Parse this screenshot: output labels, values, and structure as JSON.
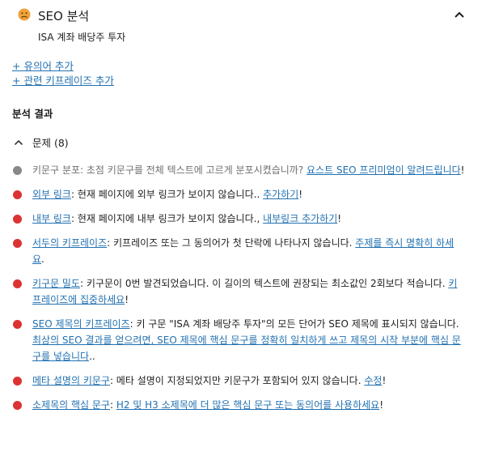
{
  "colors": {
    "accent": "#2271b1",
    "bad": "#dc3232",
    "neutral": "#888888",
    "face": "#f0a23b"
  },
  "header": {
    "icon": "face-icon",
    "title": "SEO 분석",
    "subtitle": "ISA 계좌 배당주 투자",
    "collapse_icon": "chevron-up-icon"
  },
  "add_links": [
    "+ 유의어 추가",
    "+ 관련 키프레이즈 추가"
  ],
  "section_title": "분석 결과",
  "problems": {
    "icon": "chevron-up-icon",
    "label": "문제 (8)"
  },
  "results": [
    {
      "status": "neutral",
      "text": "키문구 분포: 초점 키문구를 전체 텍스트에 고르게 분포시켰습니까? ",
      "action": "요스트 SEO 프리미엄이 알려드립니다",
      "suffix": "!"
    },
    {
      "status": "bad",
      "title": "외부 링크",
      "text": ": 현재 페이지에 외부 링크가 보이지 않습니다.. ",
      "action": "추가하기",
      "suffix": "!"
    },
    {
      "status": "bad",
      "title": "내부 링크",
      "text": ": 현재 페이지에 내부 링크가 보이지 않습니다., ",
      "action": "내부링크 추가하기",
      "suffix": "!"
    },
    {
      "status": "bad",
      "title": "서두의 키프레이즈",
      "text": ": 키프레이즈 또는 그 동의어가 첫 단락에 나타나지 않습니다. ",
      "action": "주제를 즉시 명확히 하세요",
      "suffix": "."
    },
    {
      "status": "bad",
      "title": "키구문 밀도",
      "text": ": 키구문이 0번 발견되었습니다. 이 길이의 텍스트에 권장되는 최소값인 2회보다 적습니다. ",
      "action": "키프레이즈에 집중하세요",
      "suffix": "!"
    },
    {
      "status": "bad",
      "title": "SEO 제목의 키프레이즈",
      "text": ": 키 구문 \"ISA 계좌 배당주 투자\"의 모든 단어가 SEO 제목에 표시되지 않습니다. ",
      "action": "최상의 SEO 결과를 얻으려면, SEO 제목에 핵심 문구를 정확히 일치하게 쓰고 제목의 시작 부분에 핵심 문구를 넣습니다",
      "suffix": ".."
    },
    {
      "status": "bad",
      "title": "메타 설명의 키문구",
      "text": ": 메타 설명이 지정되었지만 키문구가 포함되어 있지 않습니다. ",
      "action": "수정",
      "suffix": "!"
    },
    {
      "status": "bad",
      "title": "소제목의 핵심 문구",
      "text": ": ",
      "action": "H2 및 H3 소제목에 더 많은 핵심 문구 또는 동의어를 사용하세요",
      "suffix": "!"
    }
  ]
}
